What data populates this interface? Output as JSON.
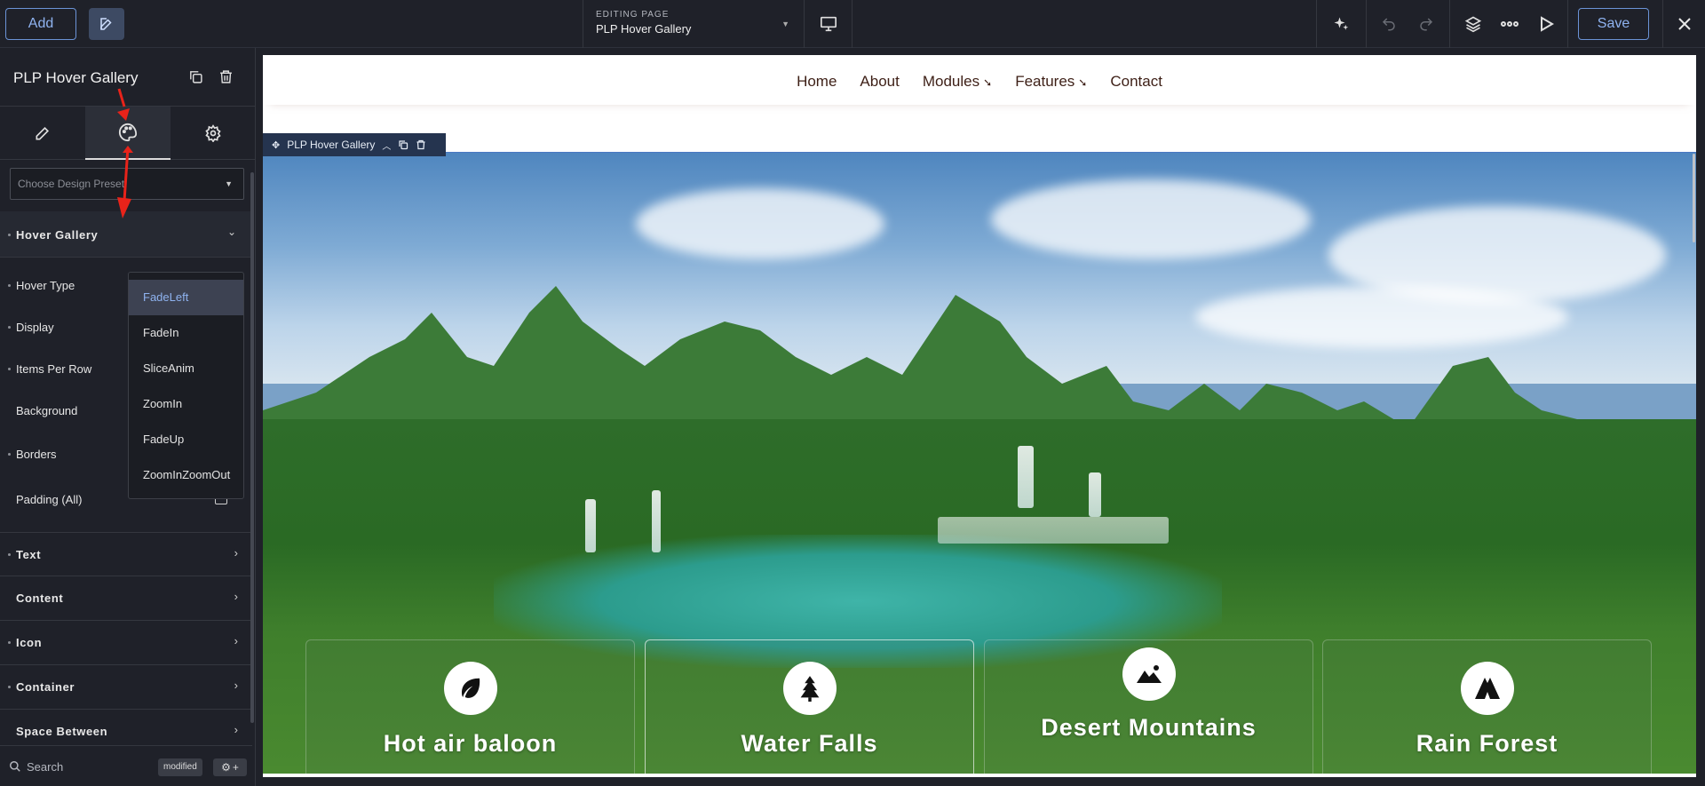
{
  "topbar": {
    "add_label": "Add",
    "editing_label": "EDITING PAGE",
    "page_name": "PLP Hover Gallery",
    "save_label": "Save"
  },
  "sidebar": {
    "module_title": "PLP Hover Gallery",
    "tabs": [
      "content",
      "design",
      "advanced"
    ],
    "active_tab": "design",
    "preset_placeholder": "Choose Design Preset",
    "open_section": "Hover Gallery",
    "properties": [
      {
        "label": "Hover Type"
      },
      {
        "label": "Display"
      },
      {
        "label": "Items Per Row"
      },
      {
        "label": "Background"
      },
      {
        "label": "Borders"
      },
      {
        "label": "Padding (All)"
      }
    ],
    "sections": [
      "Text",
      "Content",
      "Icon",
      "Container",
      "Space Between"
    ],
    "search_placeholder": "Search",
    "modified_badge": "modified"
  },
  "hover_type_dropdown": {
    "selected": "FadeLeft",
    "options": [
      "FadeLeft",
      "FadeIn",
      "SliceAnim",
      "ZoomIn",
      "FadeUp",
      "ZoomInZoomOut"
    ]
  },
  "site": {
    "nav": [
      {
        "label": "Home",
        "has_submenu": false
      },
      {
        "label": "About",
        "has_submenu": false
      },
      {
        "label": "Modules",
        "has_submenu": true
      },
      {
        "label": "Features",
        "has_submenu": true
      },
      {
        "label": "Contact",
        "has_submenu": false
      }
    ],
    "module_label": "PLP Hover Gallery",
    "cards": [
      {
        "title": "Hot air baloon",
        "icon": "leaf-icon"
      },
      {
        "title": "Water Falls",
        "icon": "tree-icon"
      },
      {
        "title": "Desert Mountains",
        "icon": "mountain-icon"
      },
      {
        "title": "Rain Forest",
        "icon": "camping-icon"
      }
    ]
  },
  "colors": {
    "accent": "#8fb3f0",
    "panel_bg": "#1f2129",
    "nav_text": "#3d1f16",
    "annotation_arrow": "#e8231a"
  }
}
